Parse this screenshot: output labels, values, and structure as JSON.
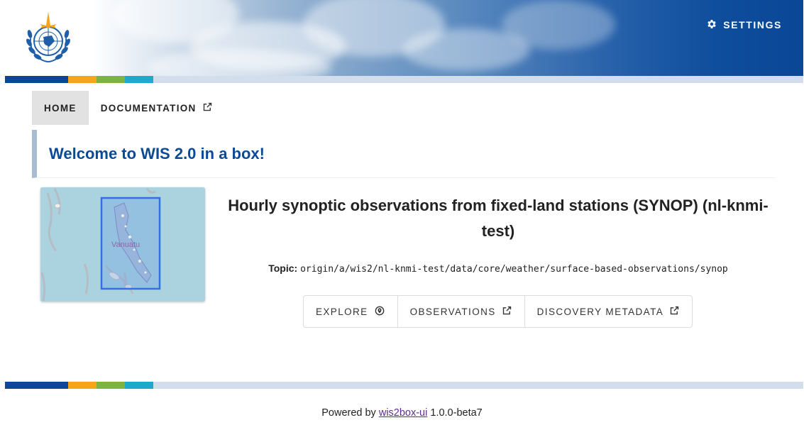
{
  "header": {
    "settings_label": "SETTINGS",
    "settings_icon": "gear-icon",
    "logo": "wmo-logo"
  },
  "colors": {
    "primary_blue": "#0a4a96",
    "stripe_blue": "#0a4796",
    "stripe_orange": "#f4a51c",
    "stripe_green": "#7cb342",
    "stripe_cyan": "#1ea7cf",
    "stripe_light": "#d2deec"
  },
  "nav": {
    "tabs": [
      {
        "label": "HOME",
        "active": true
      },
      {
        "label": "DOCUMENTATION",
        "icon": "external-link-icon"
      }
    ]
  },
  "welcome": {
    "title": "Welcome to WIS 2.0 in a box!"
  },
  "dataset": {
    "map_label": "Vanuatu",
    "title": "Hourly synoptic observations from fixed-land stations (SYNOP) (nl-knmi-test)",
    "topic_label": "Topic:",
    "topic_value": "origin/a/wis2/nl-knmi-test/data/core/weather/surface-based-observations/synop",
    "buttons": [
      {
        "label": "EXPLORE",
        "icon": "map-marker-icon"
      },
      {
        "label": "OBSERVATIONS",
        "icon": "external-link-icon"
      },
      {
        "label": "DISCOVERY METADATA",
        "icon": "external-link-icon"
      }
    ]
  },
  "footer": {
    "prefix": "Powered by",
    "link": "wis2box-ui",
    "version": "1.0.0-beta7"
  }
}
